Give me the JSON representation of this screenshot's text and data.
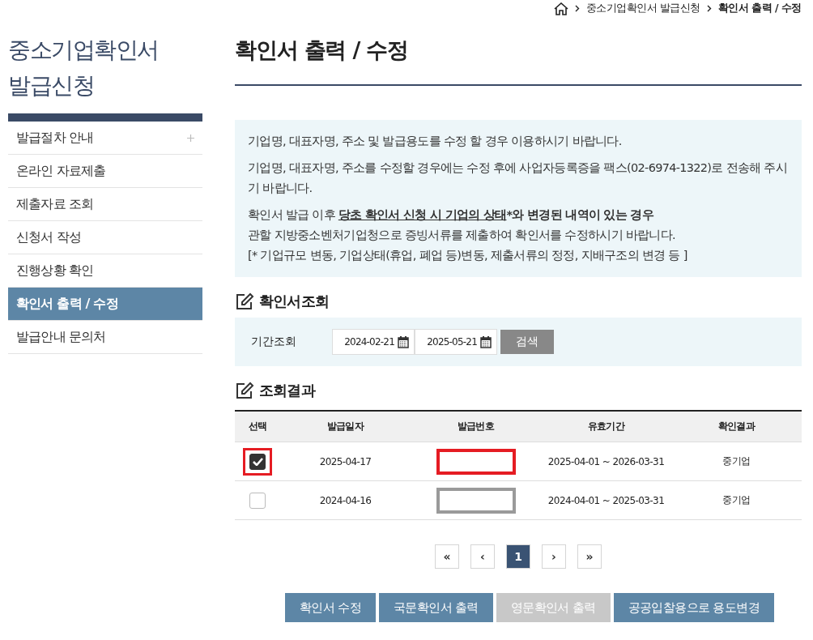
{
  "breadcrumb": [
    "중소기업확인서 발급신청",
    "확인서 출력 / 수정"
  ],
  "sidebar": {
    "title": "중소기업확인서 발급신청",
    "items": [
      {
        "label": "발급절차 안내",
        "selected": false,
        "expandable": true
      },
      {
        "label": "온라인 자료제출",
        "selected": false,
        "expandable": false
      },
      {
        "label": "제출자료 조회",
        "selected": false,
        "expandable": false
      },
      {
        "label": "신청서 작성",
        "selected": false,
        "expandable": false
      },
      {
        "label": "진행상황 확인",
        "selected": false,
        "expandable": false
      },
      {
        "label": "확인서 출력 / 수정",
        "selected": true,
        "expandable": false
      },
      {
        "label": "발급안내 문의처",
        "selected": false,
        "expandable": false
      }
    ]
  },
  "page_title": "확인서 출력 / 수정",
  "notice": {
    "paragraphs": [
      "기업명, 대표자명, 주소 및 발급용도를 수정 할 경우 이용하시기 바랍니다.",
      "기업명, 대표자명, 주소를 수정할 경우에는 수정 후에 사업자등록증을 팩스(02-6974-1322)로 전송해 주시기 바랍니다."
    ],
    "emphasis_line": {
      "prefix": "확인서 발급 이후 ",
      "underlined": "당초 확인서 신청 시 기업의 상태",
      "suffix": "*와 변경된 내역이 있는 경우"
    },
    "lines": [
      "관할 지방중소벤처기업청으로 증빙서류를 제출하여 확인서를 수정하시기 바랍니다.",
      "[* 기업규모 변동, 기업상태(휴업, 폐업 등)변동, 제출서류의 정정, 지배구조의 변경 등 ]"
    ]
  },
  "search_section": {
    "title": "확인서조회",
    "label": "기간조회",
    "from": "2024-02-21",
    "to": "2025-05-21",
    "button": "검색"
  },
  "results": {
    "title": "조회결과",
    "columns": [
      "선택",
      "발급일자",
      "발급번호",
      "유효기간",
      "확인결과"
    ],
    "rows": [
      {
        "checked": true,
        "highlighted": true,
        "date": "2025-04-17",
        "number_redaction": {
          "color": "#e51c23"
        },
        "period": "2025-04-01 ~ 2026-03-31",
        "result": "중기업"
      },
      {
        "checked": false,
        "highlighted": false,
        "date": "2024-04-16",
        "number_redaction": {
          "color": "#9a9a9a"
        },
        "period": "2024-04-01 ~ 2025-03-31",
        "result": "중기업"
      }
    ]
  },
  "pagination": [
    {
      "label": "«",
      "selected": false
    },
    {
      "label": "‹",
      "selected": false
    },
    {
      "label": "1",
      "selected": true
    },
    {
      "label": "›",
      "selected": false
    },
    {
      "label": "»",
      "selected": false
    }
  ],
  "actions": [
    {
      "label": "확인서 수정",
      "disabled": false
    },
    {
      "label": "국문확인서 출력",
      "disabled": false
    },
    {
      "label": "영문확인서 출력",
      "disabled": true
    },
    {
      "label": "공공입찰용으로 용도변경",
      "disabled": false
    }
  ]
}
